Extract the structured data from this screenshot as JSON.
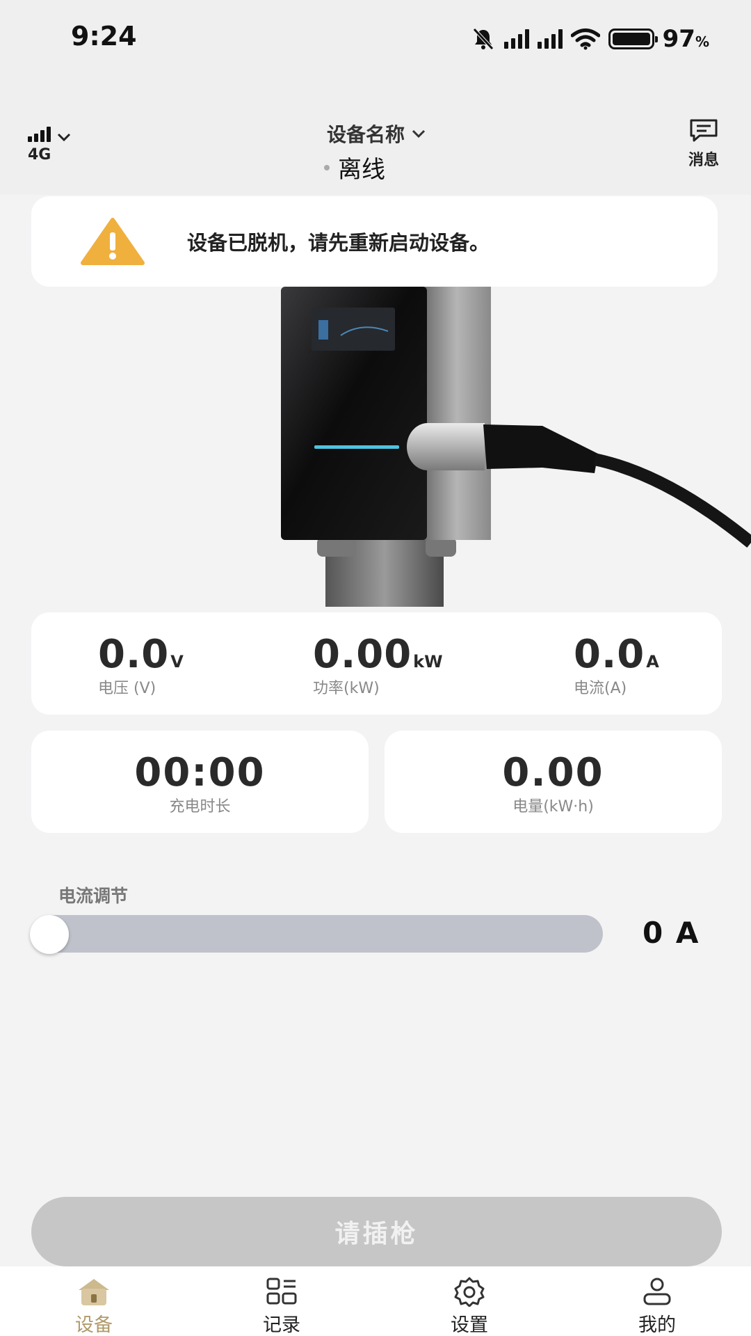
{
  "status_bar": {
    "time": "9:24",
    "battery_pct": "97",
    "battery_suffix": "%"
  },
  "header": {
    "network_label": "4G",
    "device_name": "设备名称",
    "device_status": "离线",
    "message_label": "消息"
  },
  "alert": {
    "text": "设备已脱机，请先重新启动设备。",
    "icon": "warning-icon",
    "icon_color": "#f0b03e"
  },
  "metrics": [
    {
      "value": "0.0",
      "unit": "V",
      "label": "电压 (V)"
    },
    {
      "value": "0.00",
      "unit": "kW",
      "label": "功率(kW)"
    },
    {
      "value": "0.0",
      "unit": "A",
      "label": "电流(A)"
    }
  ],
  "stats": [
    {
      "value": "00:00",
      "label": "充电时长"
    },
    {
      "value": "0.00",
      "label": "电量(kW·h)"
    }
  ],
  "current_adjust": {
    "label": "电流调节",
    "value_text": "0 A",
    "level": 0
  },
  "action_button": {
    "label": "请插枪"
  },
  "tabs": [
    {
      "label": "设备",
      "icon": "home-icon",
      "active": true
    },
    {
      "label": "记录",
      "icon": "records-icon",
      "active": false
    },
    {
      "label": "设置",
      "icon": "settings-icon",
      "active": false
    },
    {
      "label": "我的",
      "icon": "profile-icon",
      "active": false
    }
  ],
  "colors": {
    "accent": "#b09a6a",
    "disabled_button": "#c6c6c6",
    "slider_track": "#bfc2ca",
    "warning": "#f0b03e"
  }
}
